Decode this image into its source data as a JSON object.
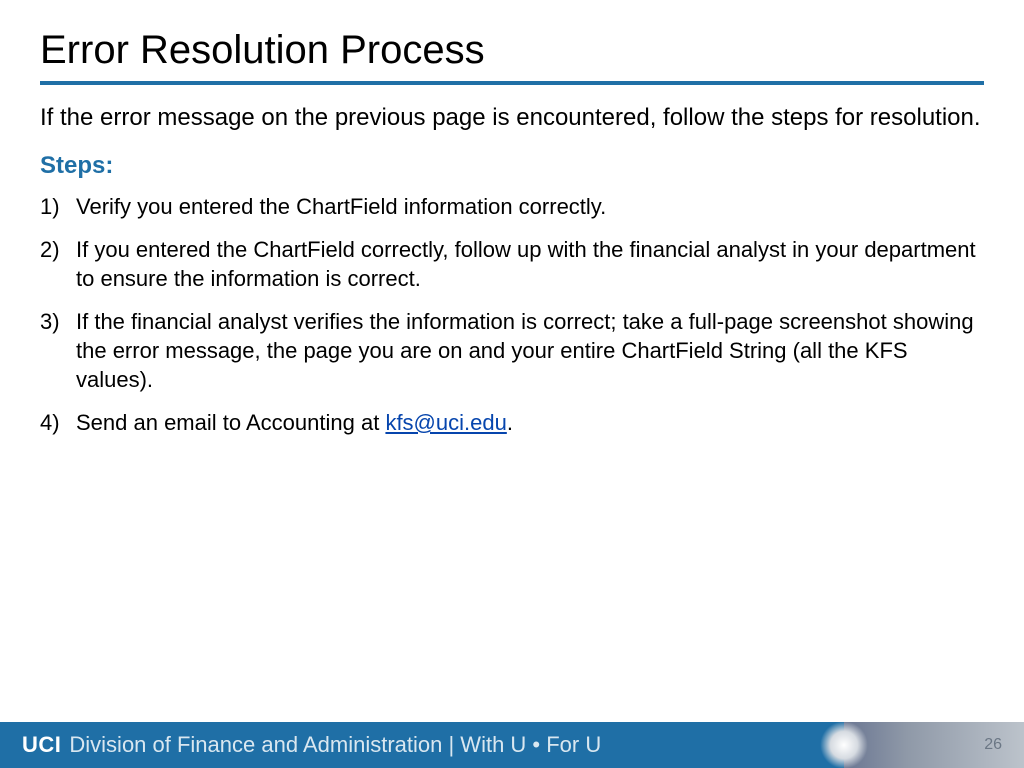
{
  "title": "Error Resolution Process",
  "intro": "If the error message on the previous page is encountered, follow the steps for resolution.",
  "steps_heading": "Steps:",
  "steps": {
    "item1": "Verify you entered the ChartField information correctly.",
    "item2": "If you entered the ChartField correctly, follow up with the financial analyst in your department to ensure the information is correct.",
    "item3": "If the financial analyst verifies the information is correct; take a full-page screenshot showing the error message, the page you are on and your entire ChartField String (all the KFS values).",
    "item4_prefix": "Send an email to Accounting at ",
    "item4_link": "kfs@uci.edu",
    "item4_suffix": "."
  },
  "footer": {
    "uci": "UCI",
    "division": "Division of Finance and Administration | With U • For U",
    "page_number": "26"
  }
}
